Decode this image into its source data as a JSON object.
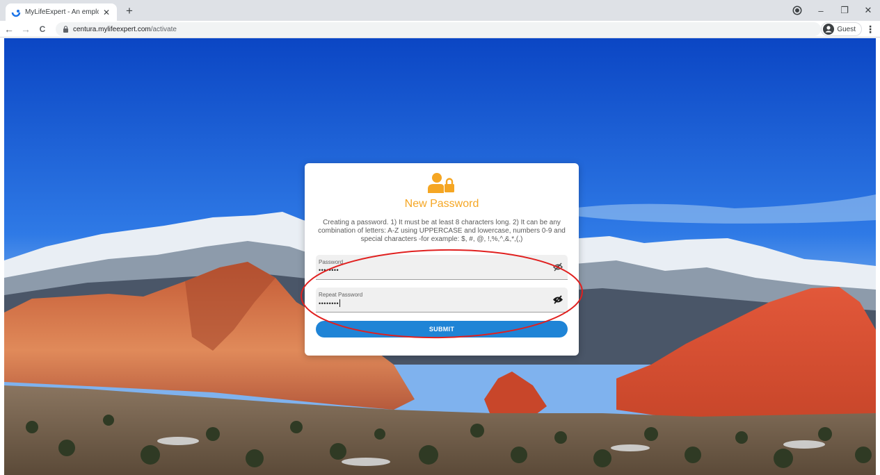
{
  "browser": {
    "tab_title": "MyLifeExpert - An employee wel",
    "new_tab_symbol": "+",
    "url_host": "centura.mylifeexpert.com",
    "url_path": "/activate",
    "profile_label": "Guest",
    "menu_symbol": "⋮",
    "window_controls": {
      "minimize": "–",
      "restore": "❐",
      "close": "✕"
    },
    "nav": {
      "back": "←",
      "forward": "→",
      "reload": "C"
    }
  },
  "form": {
    "title": "New Password",
    "description": "Creating a password. 1) It must be at least 8 characters long. 2) It can be any combination of letters: A-Z using UPPERCASE and lowercase, numbers 0-9 and special characters -for example: $, #, @, !,%,^,&,*,(,)",
    "password": {
      "label": "Password",
      "value": "••••••••"
    },
    "repeat_password": {
      "label": "Repeat Password",
      "value": "••••••••"
    },
    "submit_label": "SUBMIT"
  },
  "colors": {
    "accent": "#f5a623",
    "button": "#1f84d6",
    "annotation": "#e0201f"
  },
  "icons": [
    "user-lock-icon",
    "eye-off-icon",
    "lock-icon",
    "guest-avatar-icon"
  ]
}
